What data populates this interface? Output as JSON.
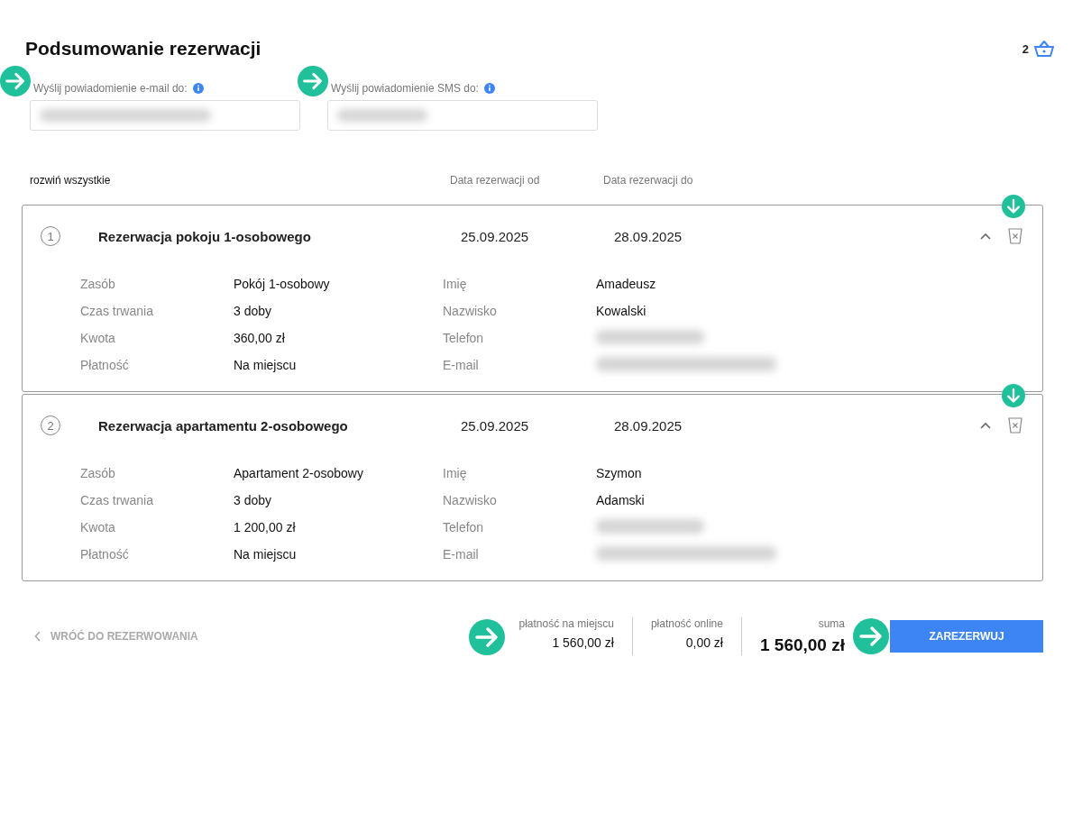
{
  "title": "Podsumowanie rezerwacji",
  "cart": {
    "count": "2"
  },
  "notify_fields": [
    {
      "label": "Wyślij powiadomienie e-mail do:",
      "value_blurred": true
    },
    {
      "label": "Wyślij powiadomienie SMS do:",
      "value_blurred": true
    }
  ],
  "list_header": {
    "expand_all": "rozwiń wszystkie",
    "columns": [
      "Data rezerwacji od",
      "Data rezerwacji do"
    ]
  },
  "reservations": [
    {
      "number": "1",
      "title": "Rezerwacja pokoju 1-osobowego",
      "date_from": "25.09.2025",
      "date_to": "28.09.2025",
      "expanded": true,
      "details": [
        {
          "label": "Zasób",
          "value": "Pokój 1-osobowy"
        },
        {
          "label": "Czas trwania",
          "value": "3 doby"
        },
        {
          "label": "Kwota",
          "value": "360,00 zł"
        },
        {
          "label": "Płatność",
          "value": "Na miejscu"
        }
      ],
      "guest": [
        {
          "label": "Imię",
          "value": "Amadeusz"
        },
        {
          "label": "Nazwisko",
          "value": "Kowalski"
        },
        {
          "label": "Telefon",
          "blurred": true
        },
        {
          "label": "E-mail",
          "blurred": true
        }
      ]
    },
    {
      "number": "2",
      "title": "Rezerwacja apartamentu 2-osobowego",
      "date_from": "25.09.2025",
      "date_to": "28.09.2025",
      "expanded": true,
      "details": [
        {
          "label": "Zasób",
          "value": "Apartament 2-osobowy"
        },
        {
          "label": "Czas trwania",
          "value": "3 doby"
        },
        {
          "label": "Kwota",
          "value": "1 200,00 zł"
        },
        {
          "label": "Płatność",
          "value": "Na miejscu"
        }
      ],
      "guest": [
        {
          "label": "Imię",
          "value": "Szymon"
        },
        {
          "label": "Nazwisko",
          "value": "Adamski"
        },
        {
          "label": "Telefon",
          "blurred": true
        },
        {
          "label": "E-mail",
          "blurred": true
        }
      ]
    }
  ],
  "footer": {
    "back": "WRÓĆ DO REZERWOWANIA",
    "totals": [
      {
        "label": "płatność na miejscu",
        "value": "1 560,00 zł",
        "kind": "normal"
      },
      {
        "label": "płatność online",
        "value": "0,00 zł",
        "kind": "normal"
      },
      {
        "label": "suma",
        "value": "1 560,00 zł",
        "kind": "grand"
      }
    ],
    "submit": "ZAREZERWUJ"
  }
}
